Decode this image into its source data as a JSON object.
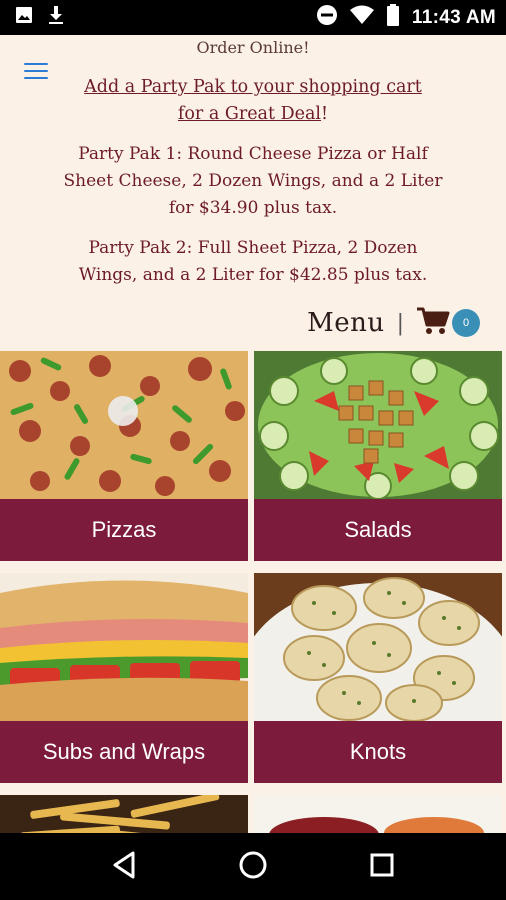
{
  "status_bar": {
    "time": "11:43 AM",
    "icons": [
      "image-icon",
      "download-icon",
      "do-not-disturb-icon",
      "wifi-icon",
      "battery-icon"
    ]
  },
  "header": {
    "order_online": "Order Online!",
    "promo_link": "Add a Party Pak to your shopping cart for a Great Deal",
    "promo_suffix": "!",
    "pak1": "Party Pak 1: Round Cheese Pizza or Half Sheet Cheese, 2 Dozen Wings, and a 2 Liter for $34.90 plus tax.",
    "pak2": "Party Pak 2: Full Sheet Pizza, 2 Dozen Wings, and a 2 Liter for $42.85 plus tax."
  },
  "menu": {
    "label": "Menu",
    "separator": "|",
    "cart_count": "0"
  },
  "categories": [
    {
      "label": "Pizzas"
    },
    {
      "label": "Salads"
    },
    {
      "label": "Subs and Wraps"
    },
    {
      "label": "Knots"
    },
    {
      "label": ""
    },
    {
      "label": ""
    }
  ],
  "colors": {
    "background": "#fbf1e6",
    "accent": "#7d1b3d",
    "text": "#6d1a2a",
    "badge": "#3a8fb7",
    "hamburger": "#2c7bd4"
  }
}
